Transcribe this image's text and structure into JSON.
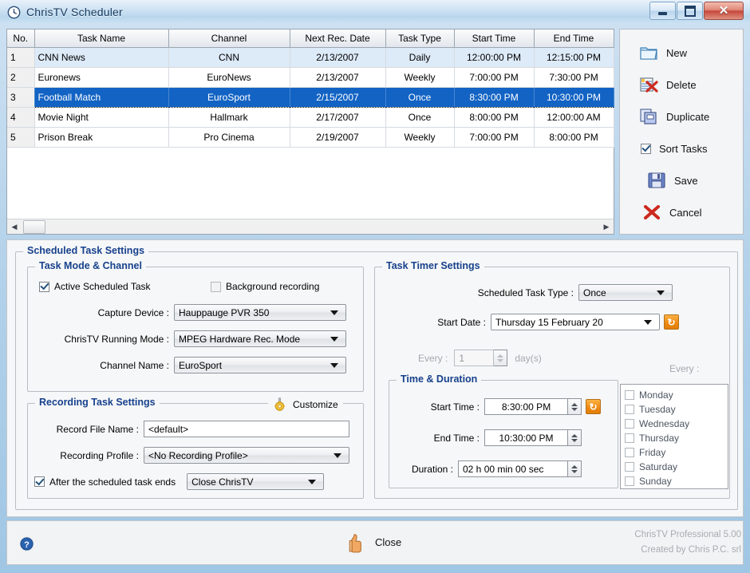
{
  "window": {
    "title": "ChrisTV Scheduler",
    "clock_icon": "clock-icon",
    "buttons": {
      "minimize": "minimize-button",
      "maximize": "maximize-button",
      "close": "close-button",
      "close_glyph": "✕"
    }
  },
  "grid": {
    "columns": [
      "No.",
      "Task Name",
      "Channel",
      "Next Rec. Date",
      "Task Type",
      "Start Time",
      "End Time"
    ],
    "rows": [
      {
        "no": "1",
        "name": "CNN News",
        "channel": "CNN",
        "next": "2/13/2007",
        "type": "Daily",
        "start": "12:00:00 PM",
        "end": "12:15:00 PM"
      },
      {
        "no": "2",
        "name": "Euronews",
        "channel": "EuroNews",
        "next": "2/13/2007",
        "type": "Weekly",
        "start": "7:00:00 PM",
        "end": "7:30:00 PM"
      },
      {
        "no": "3",
        "name": "Football Match",
        "channel": "EuroSport",
        "next": "2/15/2007",
        "type": "Once",
        "start": "8:30:00 PM",
        "end": "10:30:00 PM"
      },
      {
        "no": "4",
        "name": "Movie Night",
        "channel": "Hallmark",
        "next": "2/17/2007",
        "type": "Once",
        "start": "8:00:00 PM",
        "end": "12:00:00 AM"
      },
      {
        "no": "5",
        "name": "Prison Break",
        "channel": "Pro Cinema",
        "next": "2/19/2007",
        "type": "Weekly",
        "start": "7:00:00 PM",
        "end": "8:00:00 PM"
      }
    ],
    "selected_row_index": 2,
    "scroll_left_arrow": "◀",
    "scroll_right_arrow": "▶"
  },
  "toolbar": {
    "new_label": "New",
    "delete_label": "Delete",
    "duplicate_label": "Duplicate",
    "sort_tasks_label": "Sort Tasks",
    "sort_tasks_checked": true,
    "save_label": "Save",
    "cancel_label": "Cancel"
  },
  "settings": {
    "legend": "Scheduled Task Settings",
    "task_mode": {
      "legend": "Task Mode & Channel",
      "active_task_label": "Active Scheduled Task",
      "active_task_checked": true,
      "background_recording_label": "Background recording",
      "background_recording_checked": false,
      "capture_device_label": "Capture Device :",
      "capture_device_value": "Hauppauge PVR 350",
      "running_mode_label": "ChrisTV Running Mode :",
      "running_mode_value": "MPEG Hardware Rec. Mode",
      "channel_name_label": "Channel Name :",
      "channel_name_value": "EuroSport"
    },
    "recording": {
      "legend": "Recording Task Settings",
      "customize_label": "Customize",
      "customize_icon": "gear-icon",
      "record_file_label": "Record File Name :",
      "record_file_value": "<default>",
      "profile_label": "Recording Profile :",
      "profile_value": "<No Recording Profile>",
      "after_task_label": "After the scheduled task ends",
      "after_task_checked": true,
      "after_task_value": "Close ChrisTV"
    },
    "timer": {
      "legend": "Task Timer Settings",
      "task_type_label": "Scheduled Task Type :",
      "task_type_value": "Once",
      "start_date_label": "Start Date :",
      "start_date_value": "Thursday   15  February   20",
      "every_label": "Every :",
      "every_value": "1",
      "every_unit": "day(s)",
      "every_days_label": "Every :",
      "refresh_icon": "refresh-icon",
      "refresh_glyph": "↻"
    },
    "time_duration": {
      "legend": "Time & Duration",
      "start_time_label": "Start Time :",
      "start_time_value": "8:30:00 PM",
      "end_time_label": "End Time :",
      "end_time_value": "10:30:00 PM",
      "duration_label": "Duration :",
      "duration_value": "02 h 00 min 00 sec"
    },
    "days": [
      {
        "label": "Monday",
        "checked": false
      },
      {
        "label": "Tuesday",
        "checked": false
      },
      {
        "label": "Wednesday",
        "checked": false
      },
      {
        "label": "Thursday",
        "checked": false
      },
      {
        "label": "Friday",
        "checked": false
      },
      {
        "label": "Saturday",
        "checked": false
      },
      {
        "label": "Sunday",
        "checked": false
      }
    ]
  },
  "statusbar": {
    "help_icon": "help-icon",
    "close_label": "Close",
    "close_icon": "thumbs-up-icon",
    "version_line1": "ChrisTV Professional 5.00",
    "version_line2": "Created by Chris P.C. srl"
  },
  "colors": {
    "selection_blue": "#1263c4",
    "alt_row_blue": "#ddeaf8",
    "legend_blue": "#17418c",
    "accent_orange": "#ef8b14"
  }
}
